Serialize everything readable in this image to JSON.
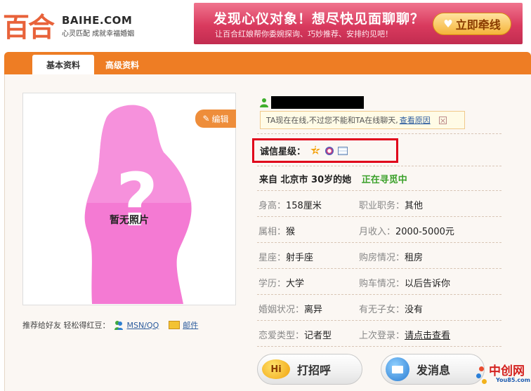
{
  "header": {
    "logo_cn": "百合",
    "logo_en": "BAIHE.COM",
    "logo_tagline": "心灵匹配 成就幸福婚姻",
    "banner": {
      "title": "发现心仪对象！想尽快见面聊聊？",
      "subtitle": "让百合红娘帮你委婉探询、巧妙推荐、安排约见吧！",
      "button_label": "立即牵线"
    }
  },
  "tabs": [
    {
      "label": "基本资料",
      "active": true
    },
    {
      "label": "高级资料",
      "active": false
    }
  ],
  "photo": {
    "placeholder_text": "暂无照片",
    "edit_label": "编辑"
  },
  "share": {
    "prompt": "推荐给好友 轻松得红豆：",
    "msn_label": "MSN/QQ",
    "mail_label": "邮件"
  },
  "profile": {
    "online_note": "TA现在在线,不过您不能和TA在线聊天,",
    "online_link": "查看原因",
    "credit_label": "诚信星级：",
    "credit_star": "2",
    "origin": "来自 北京市 30岁的她",
    "status": "正在寻觅中",
    "attributes": {
      "height": {
        "label": "身高：",
        "value": "158厘米"
      },
      "job": {
        "label": "职业职务：",
        "value": "其他"
      },
      "zodiac": {
        "label": "属相：",
        "value": "猴"
      },
      "income": {
        "label": "月收入：",
        "value": "2000-5000元"
      },
      "constellation": {
        "label": "星座：",
        "value": "射手座"
      },
      "housing": {
        "label": "购房情况：",
        "value": "租房"
      },
      "education": {
        "label": "学历：",
        "value": "大学"
      },
      "car": {
        "label": "购车情况：",
        "value": "以后告诉你"
      },
      "marital": {
        "label": "婚姻状况：",
        "value": "离异"
      },
      "children": {
        "label": "有无子女：",
        "value": "没有"
      },
      "love_type": {
        "label": "恋爱类型：",
        "value": "记者型"
      },
      "last_login": {
        "label": "上次登录：",
        "value": "请点击查看"
      }
    }
  },
  "actions": {
    "greet_icon_text": "Hi",
    "greet_label": "打招呼",
    "message_label": "发消息"
  },
  "watermark": {
    "cn": "中创网",
    "en": "You85.com"
  },
  "colors": {
    "brand_orange": "#ee7d24",
    "banner_pink": "#d93a5e",
    "highlight_red": "#e0001a",
    "status_green": "#3ba12a",
    "link_blue": "#2c5c9e"
  }
}
